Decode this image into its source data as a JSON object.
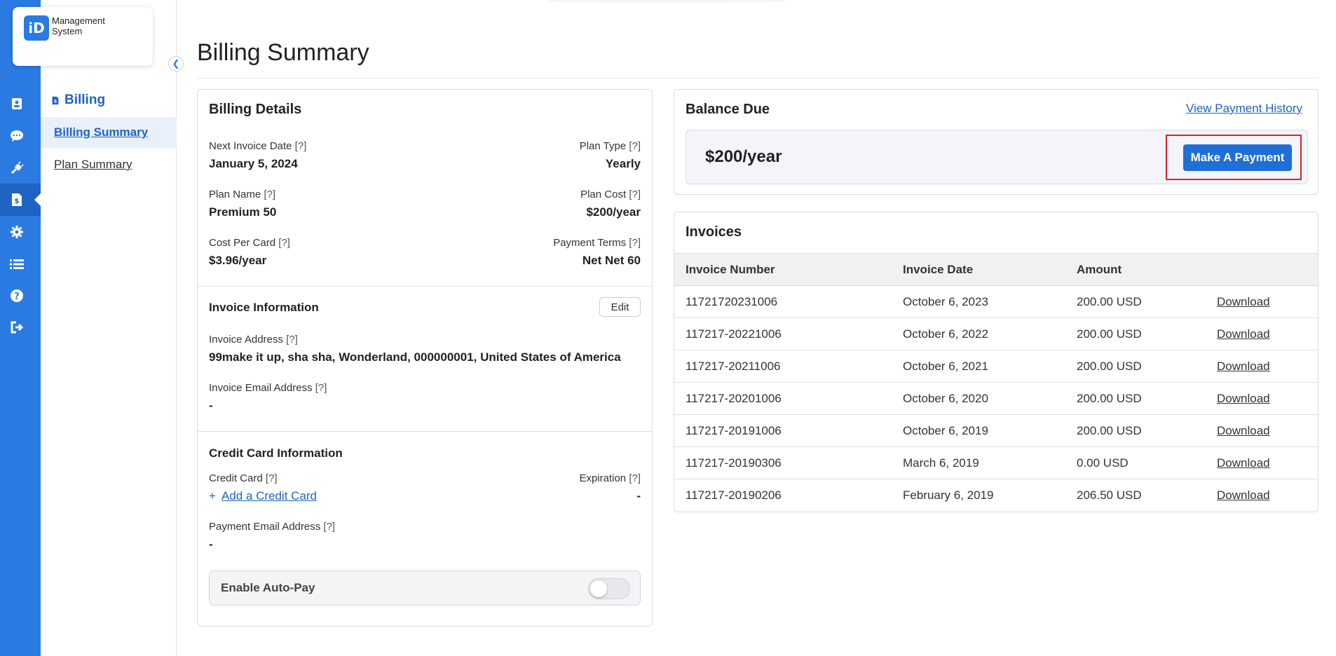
{
  "app": {
    "logo_letters": "iD",
    "logo_name": "Management System"
  },
  "rail": {
    "icons": [
      "contact-card-icon",
      "chat-icon",
      "plugin-icon",
      "billing-document-icon",
      "settings-gear-icon",
      "list-icon",
      "help-icon",
      "logout-icon"
    ],
    "active_index": 3
  },
  "subnav": {
    "heading": "Billing",
    "items": [
      {
        "label": "Billing Summary",
        "active": true
      },
      {
        "label": "Plan Summary",
        "active": false
      }
    ]
  },
  "page": {
    "title": "Billing Summary"
  },
  "billing_details": {
    "title": "Billing Details",
    "next_invoice_label": "Next Invoice Date",
    "next_invoice_value": "January 5, 2024",
    "plan_type_label": "Plan Type",
    "plan_type_value": "Yearly",
    "plan_name_label": "Plan Name",
    "plan_name_value": "Premium 50",
    "plan_cost_label": "Plan Cost",
    "plan_cost_value": "$200/year",
    "cost_per_card_label": "Cost Per Card",
    "cost_per_card_value": "$3.96/year",
    "payment_terms_label": "Payment Terms",
    "payment_terms_value": "Net Net 60",
    "hint": "[?]"
  },
  "invoice_info": {
    "title": "Invoice Information",
    "edit_label": "Edit",
    "address_label": "Invoice Address",
    "address_value": "99make it up, sha sha, Wonderland, 000000001, United States of America",
    "email_label": "Invoice Email Address",
    "email_value": "-"
  },
  "credit_card": {
    "title": "Credit Card Information",
    "card_label": "Credit Card",
    "add_label": "Add a Credit Card",
    "add_symbol": "+",
    "expiration_label": "Expiration",
    "expiration_value": "-",
    "payment_email_label": "Payment Email Address",
    "payment_email_value": "-",
    "autopay_label": "Enable Auto-Pay",
    "autopay_enabled": false
  },
  "balance": {
    "title": "Balance Due",
    "history_link": "View Payment History",
    "amount": "$200/year",
    "pay_button": "Make A Payment",
    "highlight_color": "#d9232e"
  },
  "invoices": {
    "title": "Invoices",
    "columns": [
      "Invoice Number",
      "Invoice Date",
      "Amount",
      ""
    ],
    "download_label": "Download",
    "rows": [
      {
        "number": "11721720231006",
        "date": "October 6, 2023",
        "amount": "200.00 USD"
      },
      {
        "number": "117217-20221006",
        "date": "October 6, 2022",
        "amount": "200.00 USD"
      },
      {
        "number": "117217-20211006",
        "date": "October 6, 2021",
        "amount": "200.00 USD"
      },
      {
        "number": "117217-20201006",
        "date": "October 6, 2020",
        "amount": "200.00 USD"
      },
      {
        "number": "117217-20191006",
        "date": "October 6, 2019",
        "amount": "200.00 USD"
      },
      {
        "number": "117217-20190306",
        "date": "March 6, 2019",
        "amount": "0.00 USD"
      },
      {
        "number": "117217-20190206",
        "date": "February 6, 2019",
        "amount": "206.50 USD"
      }
    ]
  },
  "colors": {
    "primary": "#2a7ae2",
    "primary_dark": "#1f63c4",
    "button": "#1f6fd6"
  }
}
